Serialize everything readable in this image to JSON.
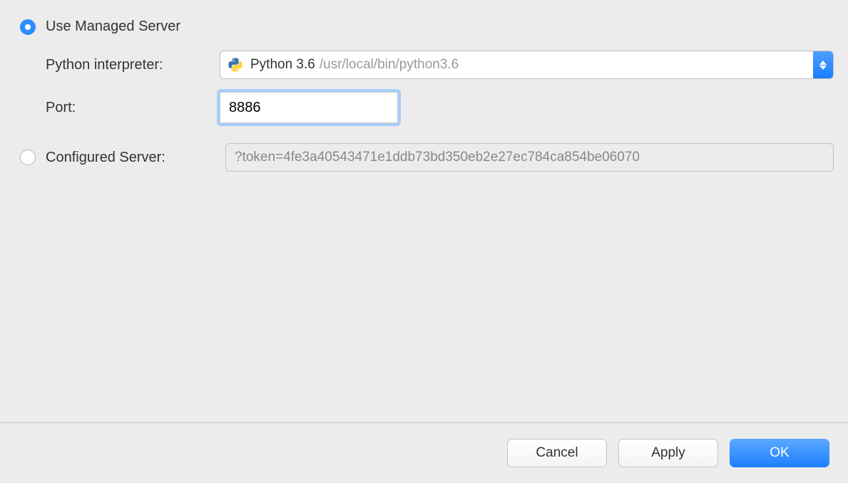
{
  "options": {
    "use_managed_label": "Use Managed Server",
    "configured_label": "Configured Server:"
  },
  "fields": {
    "interpreter_label": "Python interpreter:",
    "port_label": "Port:"
  },
  "interpreter": {
    "name": "Python 3.6",
    "path": "/usr/local/bin/python3.6"
  },
  "port": {
    "value": "8886"
  },
  "configured": {
    "token": "?token=4fe3a40543471e1ddb73bd350eb2e27ec784ca854be06070"
  },
  "buttons": {
    "cancel": "Cancel",
    "apply": "Apply",
    "ok": "OK"
  }
}
